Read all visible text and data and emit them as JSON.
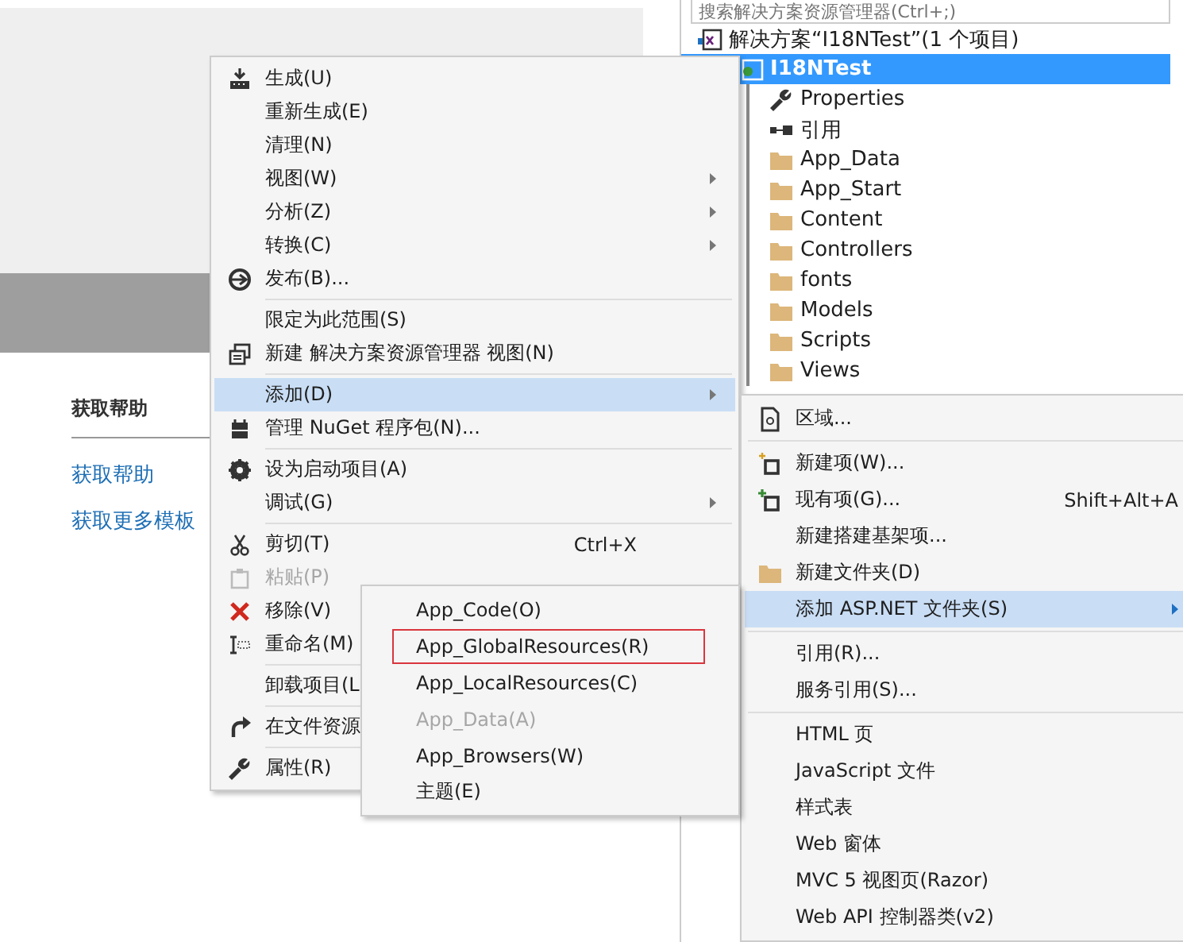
{
  "start_page": {
    "help_heading": "获取帮助",
    "links": [
      "获取帮助",
      "获取更多模板"
    ]
  },
  "solution_explorer": {
    "search": {
      "placeholder": "搜索解决方案资源管理器(Ctrl+;)"
    },
    "solution": {
      "label": "解决方案“I18NTest”(1 个项目)"
    },
    "project": {
      "label": "I18NTest",
      "selected": true
    },
    "items": [
      {
        "label": "Properties",
        "kind": "properties"
      },
      {
        "label": "引用",
        "kind": "references"
      },
      {
        "label": "App_Data",
        "kind": "folder"
      },
      {
        "label": "App_Start",
        "kind": "folder"
      },
      {
        "label": "Content",
        "kind": "folder"
      },
      {
        "label": "Controllers",
        "kind": "folder"
      },
      {
        "label": "fonts",
        "kind": "folder"
      },
      {
        "label": "Models",
        "kind": "folder"
      },
      {
        "label": "Scripts",
        "kind": "folder"
      },
      {
        "label": "Views",
        "kind": "folder"
      }
    ]
  },
  "context_menu": {
    "groups": [
      {
        "items": [
          {
            "label": "生成(U)",
            "submenu": false,
            "disabled": false,
            "selected": false
          },
          {
            "label": "重新生成(E)",
            "submenu": false,
            "disabled": false,
            "selected": false
          },
          {
            "label": "清理(N)",
            "submenu": false,
            "disabled": false,
            "selected": false
          },
          {
            "label": "视图(W)",
            "submenu": true,
            "disabled": false,
            "selected": false
          },
          {
            "label": "分析(Z)",
            "submenu": true,
            "disabled": false,
            "selected": false
          },
          {
            "label": "转换(C)",
            "submenu": true,
            "disabled": false,
            "selected": false
          },
          {
            "label": "发布(B)...",
            "submenu": false,
            "disabled": false,
            "selected": false
          }
        ]
      },
      {
        "items": [
          {
            "label": "限定为此范围(S)",
            "submenu": false,
            "disabled": false,
            "selected": false
          },
          {
            "label": "新建 解决方案资源管理器 视图(N)",
            "submenu": false,
            "disabled": false,
            "selected": false
          }
        ]
      },
      {
        "items": [
          {
            "label": "添加(D)",
            "submenu": true,
            "disabled": false,
            "selected": true
          },
          {
            "label": "管理 NuGet 程序包(N)...",
            "submenu": false,
            "disabled": false,
            "selected": false
          }
        ]
      },
      {
        "items": [
          {
            "label": "设为启动项目(A)",
            "submenu": false,
            "disabled": false,
            "selected": false
          },
          {
            "label": "调试(G)",
            "submenu": true,
            "disabled": false,
            "selected": false
          }
        ]
      },
      {
        "items": [
          {
            "label": "剪切(T)",
            "shortcut": "Ctrl+X",
            "submenu": false,
            "disabled": false,
            "selected": false
          },
          {
            "label": "粘贴(P)",
            "submenu": false,
            "disabled": true,
            "selected": false
          },
          {
            "label": "移除(V)",
            "submenu": false,
            "disabled": false,
            "selected": false
          },
          {
            "label": "重命名(M)",
            "submenu": false,
            "disabled": false,
            "selected": false
          }
        ]
      },
      {
        "items": [
          {
            "label": "卸载项目(L",
            "submenu": false,
            "disabled": false,
            "selected": false
          }
        ]
      },
      {
        "items": [
          {
            "label": "在文件资源",
            "submenu": false,
            "disabled": false,
            "selected": false
          }
        ]
      },
      {
        "items": [
          {
            "label": "属性(R)",
            "submenu": false,
            "disabled": false,
            "selected": false
          }
        ]
      }
    ]
  },
  "add_submenu": {
    "groups": [
      {
        "items": [
          {
            "label": "区域...",
            "submenu": false,
            "selected": false
          }
        ]
      },
      {
        "items": [
          {
            "label": "新建项(W)...",
            "submenu": false,
            "selected": false
          },
          {
            "label": "现有项(G)...",
            "shortcut": "Shift+Alt+A",
            "submenu": false,
            "selected": false
          },
          {
            "label": "新建搭建基架项...",
            "submenu": false,
            "selected": false
          },
          {
            "label": "新建文件夹(D)",
            "submenu": false,
            "selected": false
          },
          {
            "label": "添加 ASP.NET 文件夹(S)",
            "submenu": true,
            "selected": true
          }
        ]
      },
      {
        "items": [
          {
            "label": "引用(R)...",
            "submenu": false,
            "selected": false
          },
          {
            "label": "服务引用(S)...",
            "submenu": false,
            "selected": false
          }
        ]
      },
      {
        "items": [
          {
            "label": "HTML 页",
            "submenu": false,
            "selected": false
          },
          {
            "label": "JavaScript 文件",
            "submenu": false,
            "selected": false
          },
          {
            "label": "样式表",
            "submenu": false,
            "selected": false
          },
          {
            "label": "Web 窗体",
            "submenu": false,
            "selected": false
          },
          {
            "label": "MVC 5 视图页(Razor)",
            "submenu": false,
            "selected": false
          },
          {
            "label": "Web API 控制器类(v2)",
            "submenu": false,
            "selected": false
          }
        ]
      }
    ]
  },
  "aspnet_folder_submenu": {
    "items": [
      {
        "label": "App_Code(O)",
        "disabled": false,
        "outlined": false
      },
      {
        "label": "App_GlobalResources(R)",
        "disabled": false,
        "outlined": true
      },
      {
        "label": "App_LocalResources(C)",
        "disabled": false,
        "outlined": false
      },
      {
        "label": "App_Data(A)",
        "disabled": true,
        "outlined": false
      },
      {
        "label": "App_Browsers(W)",
        "disabled": false,
        "outlined": false
      },
      {
        "label": "主题(E)",
        "disabled": false,
        "outlined": false
      }
    ]
  }
}
